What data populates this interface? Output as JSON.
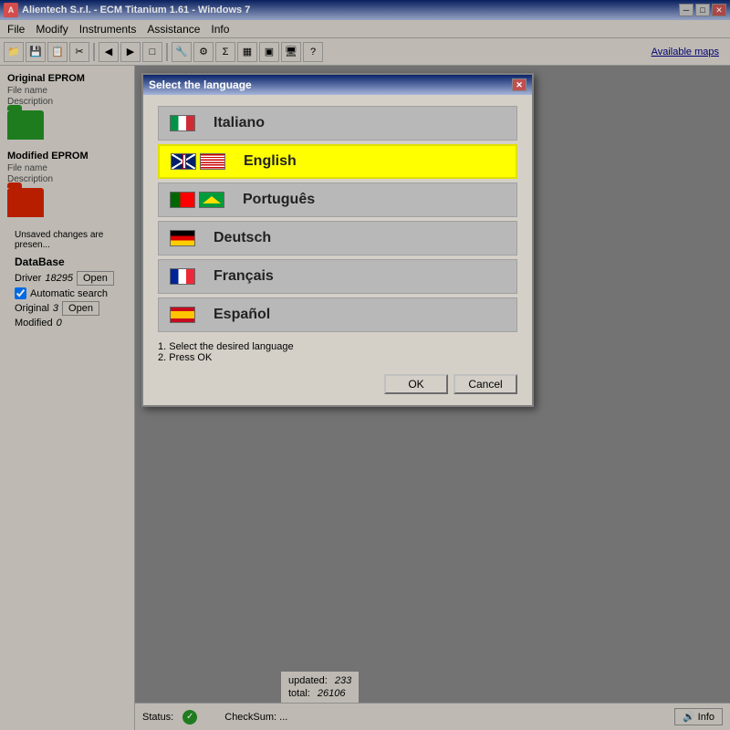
{
  "window": {
    "title": "Alientech S.r.l. - ECM Titanium 1.61 - Windows 7",
    "icon_label": "A"
  },
  "menu": {
    "items": [
      "File",
      "Modify",
      "Instruments",
      "Assistance",
      "Info"
    ]
  },
  "toolbar": {
    "available_maps": "Available maps"
  },
  "dialog": {
    "title": "Select the language",
    "instruction_1": "1. Select the desired language",
    "instruction_2": "2. Press OK",
    "ok_label": "OK",
    "cancel_label": "Cancel",
    "languages": [
      {
        "id": "it",
        "name": "Italiano",
        "flags": [
          "flag-it"
        ]
      },
      {
        "id": "en",
        "name": "English",
        "flags": [
          "flag-uk",
          "flag-us"
        ],
        "selected": true
      },
      {
        "id": "pt",
        "name": "Português",
        "flags": [
          "flag-pt",
          "flag-br"
        ]
      },
      {
        "id": "de",
        "name": "Deutsch",
        "flags": [
          "flag-de"
        ]
      },
      {
        "id": "fr",
        "name": "Français",
        "flags": [
          "flag-fr"
        ]
      },
      {
        "id": "es",
        "name": "Español",
        "flags": [
          "flag-es"
        ]
      }
    ]
  },
  "left_panel": {
    "original_eprom": {
      "title": "Original EPROM",
      "file_name_label": "File name",
      "description_label": "Description"
    },
    "modified_eprom": {
      "title": "Modified EPROM",
      "file_name_label": "File name",
      "description_label": "Description"
    },
    "unsaved_msg": "Unsaved changes are presen..."
  },
  "database": {
    "title": "DataBase",
    "driver_label": "Driver",
    "driver_value": "18295",
    "open_label": "Open",
    "updated_label": "updated:",
    "updated_value": "233",
    "auto_search_label": "Automatic search",
    "original_label": "Original",
    "original_value": "3",
    "total_label": "total:",
    "total_value": "26106",
    "modified_label": "Modified",
    "modified_value": "0",
    "status_label": "Status:",
    "checksum_label": "CheckSum: ...",
    "info_label": "Info"
  }
}
